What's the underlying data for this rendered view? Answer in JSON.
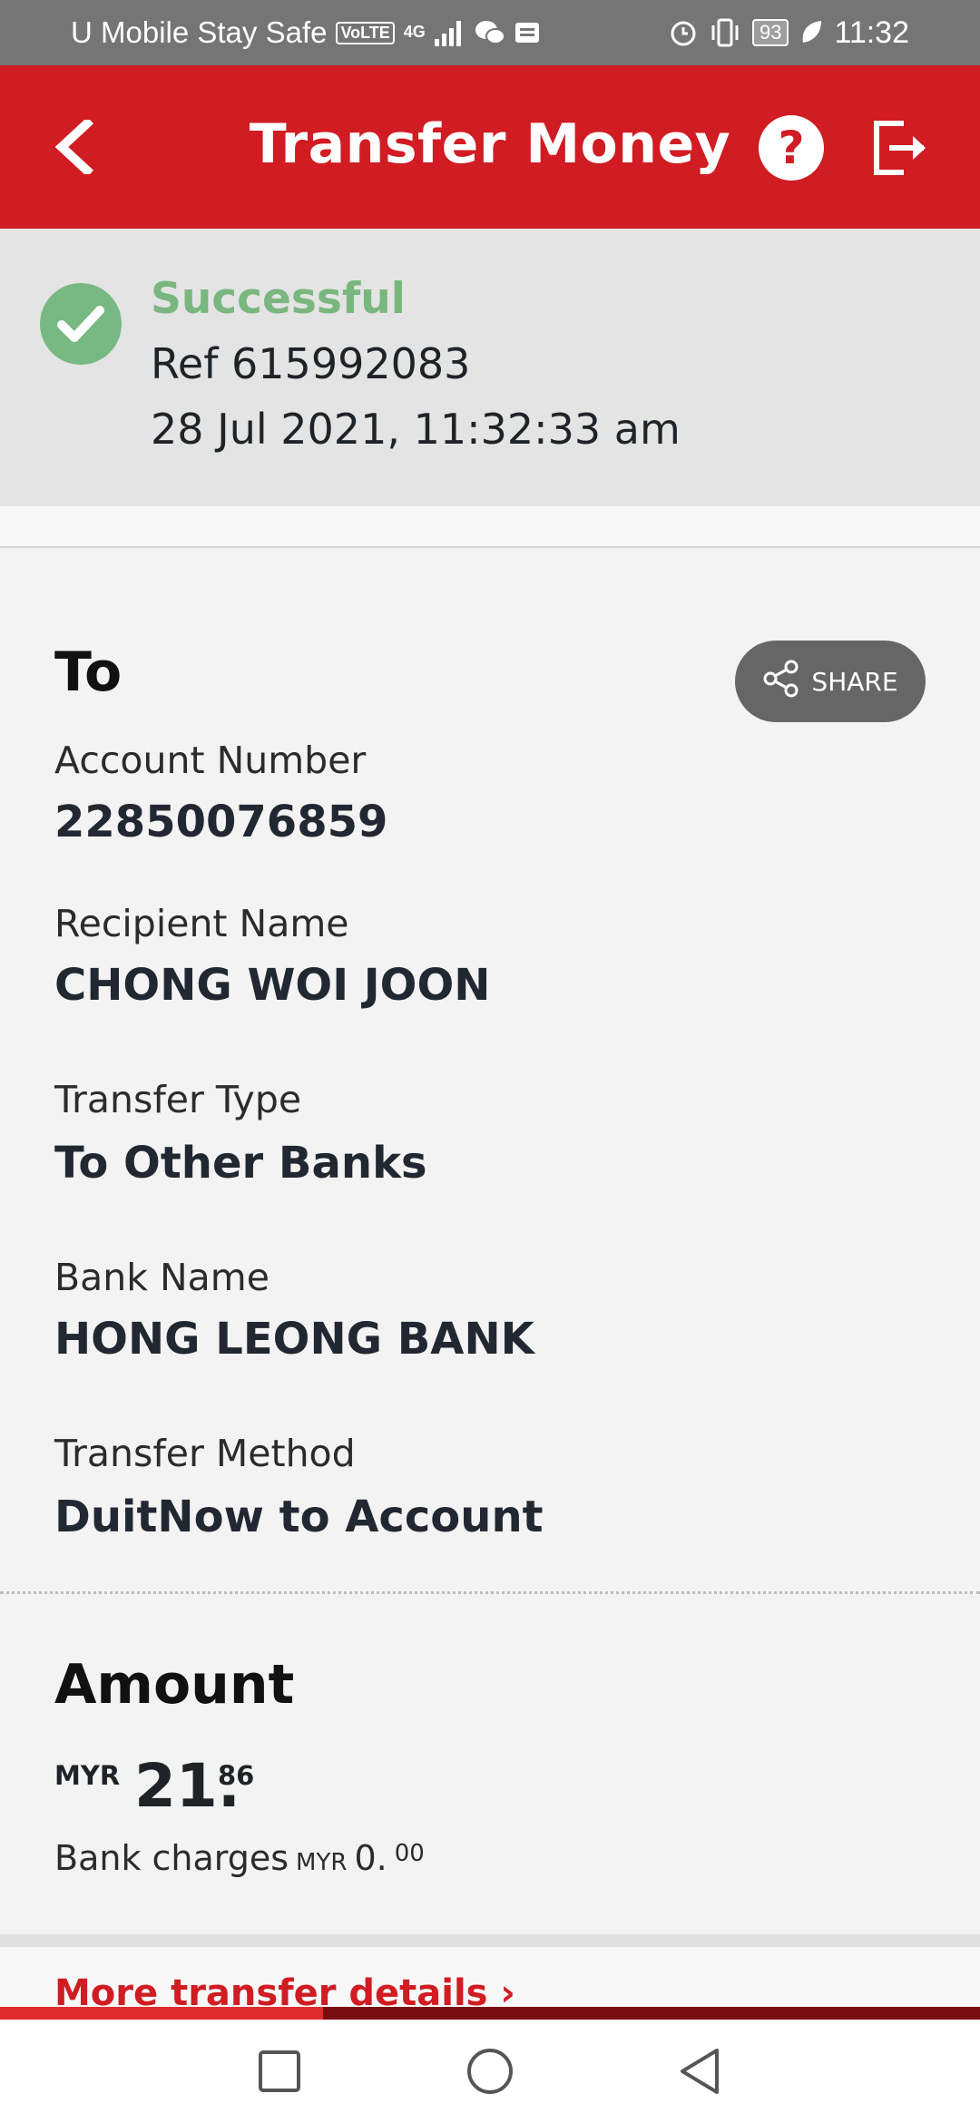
{
  "status_bar": {
    "carrier": "U Mobile Stay Safe",
    "volte": "VoLTE",
    "network": "4G",
    "battery": "93",
    "time": "11:32",
    "icons": [
      "volte-icon",
      "signal-icon",
      "wechat-icon",
      "message-icon",
      "alarm-icon",
      "vibrate-icon",
      "battery-icon",
      "leaf-icon"
    ]
  },
  "header": {
    "title": "Transfer Money",
    "help_label": "?",
    "icons": [
      "back-icon",
      "help-icon",
      "logout-icon"
    ]
  },
  "status": {
    "label": "Successful",
    "ref": "Ref 615992083",
    "datetime": "28 Jul 2021, 11:32:33 am",
    "color": "#79b77f"
  },
  "recipient": {
    "title": "To",
    "share_label": "SHARE",
    "fields": [
      {
        "label": "Account Number",
        "value": "22850076859"
      },
      {
        "label": "Recipient Name",
        "value": "CHONG WOI JOON"
      },
      {
        "label": "Transfer Type",
        "value": "To Other Banks"
      },
      {
        "label": "Bank Name",
        "value": "HONG LEONG BANK"
      },
      {
        "label": "Transfer Method",
        "value": "DuitNow to Account"
      }
    ]
  },
  "amount": {
    "title": "Amount",
    "currency": "MYR",
    "integer": "21.",
    "decimal": "86",
    "charges_label": "Bank charges",
    "charges_currency": "MYR",
    "charges_integer": "0.",
    "charges_decimal": "00"
  },
  "more_details": {
    "label": "More transfer details",
    "arrow": "›"
  },
  "progress": {
    "fraction": 0.33
  },
  "colors": {
    "brand": "#d01c22",
    "success": "#79b77f",
    "share_button": "#666666"
  },
  "nav_bar": {
    "icons": [
      "recent-apps-icon",
      "home-icon",
      "back-nav-icon"
    ]
  }
}
